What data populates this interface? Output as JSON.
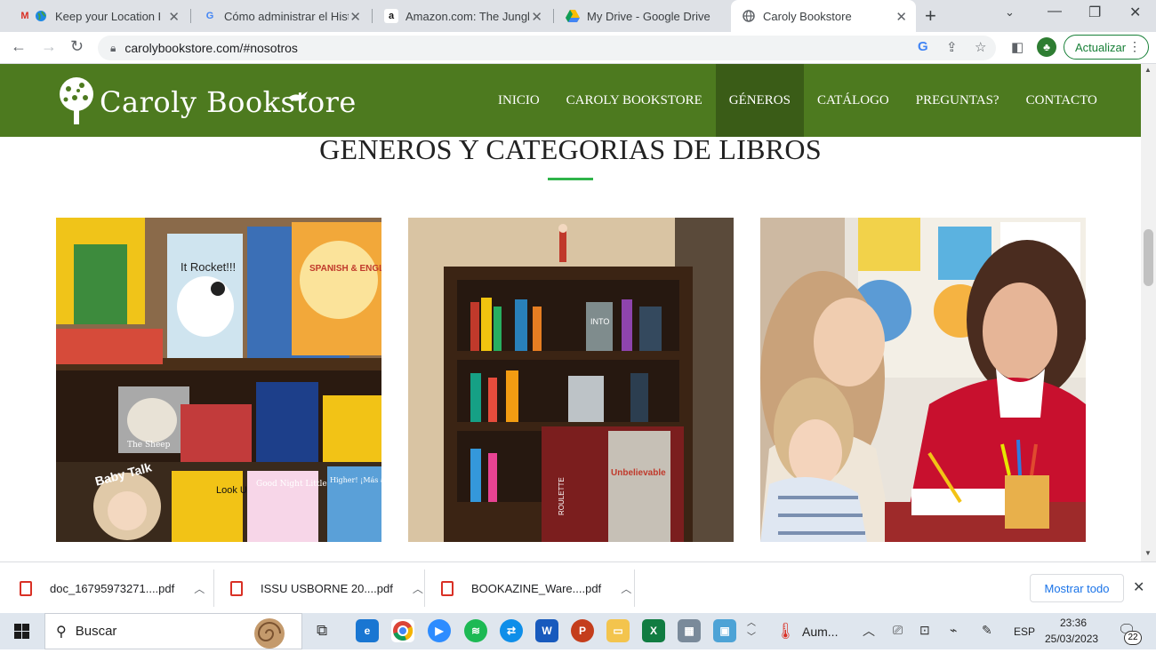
{
  "browser": {
    "tabs": [
      {
        "title": "Keep your Location Hi",
        "icon": "gmail-icon"
      },
      {
        "title": "Cómo administrar el Histo",
        "icon": "google-icon"
      },
      {
        "title": "Amazon.com: The Jungle",
        "icon": "amazon-icon"
      },
      {
        "title": "My Drive - Google Drive",
        "icon": "drive-icon"
      },
      {
        "title": "Caroly Bookstore",
        "icon": "globe-icon"
      }
    ],
    "url": "carolybookstore.com/#nosotros",
    "update_label": "Actualizar"
  },
  "site": {
    "logo_text": "Caroly Bookstore",
    "menu": [
      {
        "label": "INICIO"
      },
      {
        "label": "CAROLY BOOKSTORE"
      },
      {
        "label": "GÉNEROS"
      },
      {
        "label": "CATÁLOGO"
      },
      {
        "label": "PREGUNTAS?"
      },
      {
        "label": "CONTACTO"
      }
    ],
    "page_title": "GENEROS Y CATEGORIAS DE LIBROS",
    "book_labels": [
      "It Rocket!!!",
      "SPANISH & ENGLISH WORDS",
      "Baby Talk",
      "Look Up",
      "Good Night Little Sister",
      "Higher! ¡Más alto!",
      "The Sheep",
      "INTO",
      "Unbelievable",
      "ROULETTE"
    ]
  },
  "downloads": {
    "items": [
      {
        "name": "doc_16795973271....pdf"
      },
      {
        "name": "ISSU USBORNE 20....pdf"
      },
      {
        "name": "BOOKAZINE_Ware....pdf"
      }
    ],
    "show_all": "Mostrar todo"
  },
  "taskbar": {
    "search_placeholder": "Buscar",
    "weather": "Aum...",
    "language": "ESP",
    "time": "23:36",
    "date": "25/03/2023",
    "notifications": "22"
  },
  "colors": {
    "header_green": "#4d7a1f",
    "active_menu": "#3a5c17",
    "accent_underline": "#2fb44a"
  }
}
